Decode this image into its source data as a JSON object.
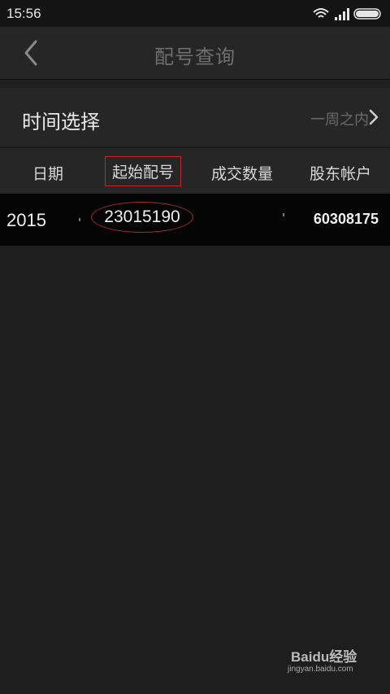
{
  "status_bar": {
    "time": "15:56"
  },
  "nav": {
    "title": "配号查询"
  },
  "time_selector": {
    "label": "时间选择",
    "value": "一周之内"
  },
  "table": {
    "headers": [
      "日期",
      "起始配号",
      "成交数量",
      "股东帐户"
    ],
    "rows": [
      {
        "date": "2015",
        "start_no": "23015190",
        "quantity": "",
        "account": "60308175"
      }
    ]
  },
  "watermark": {
    "brand": "Baidu经验",
    "url": "jingyan.baidu.com"
  },
  "colors": {
    "background": "#1e1e1e",
    "highlight": "#c0282b"
  }
}
